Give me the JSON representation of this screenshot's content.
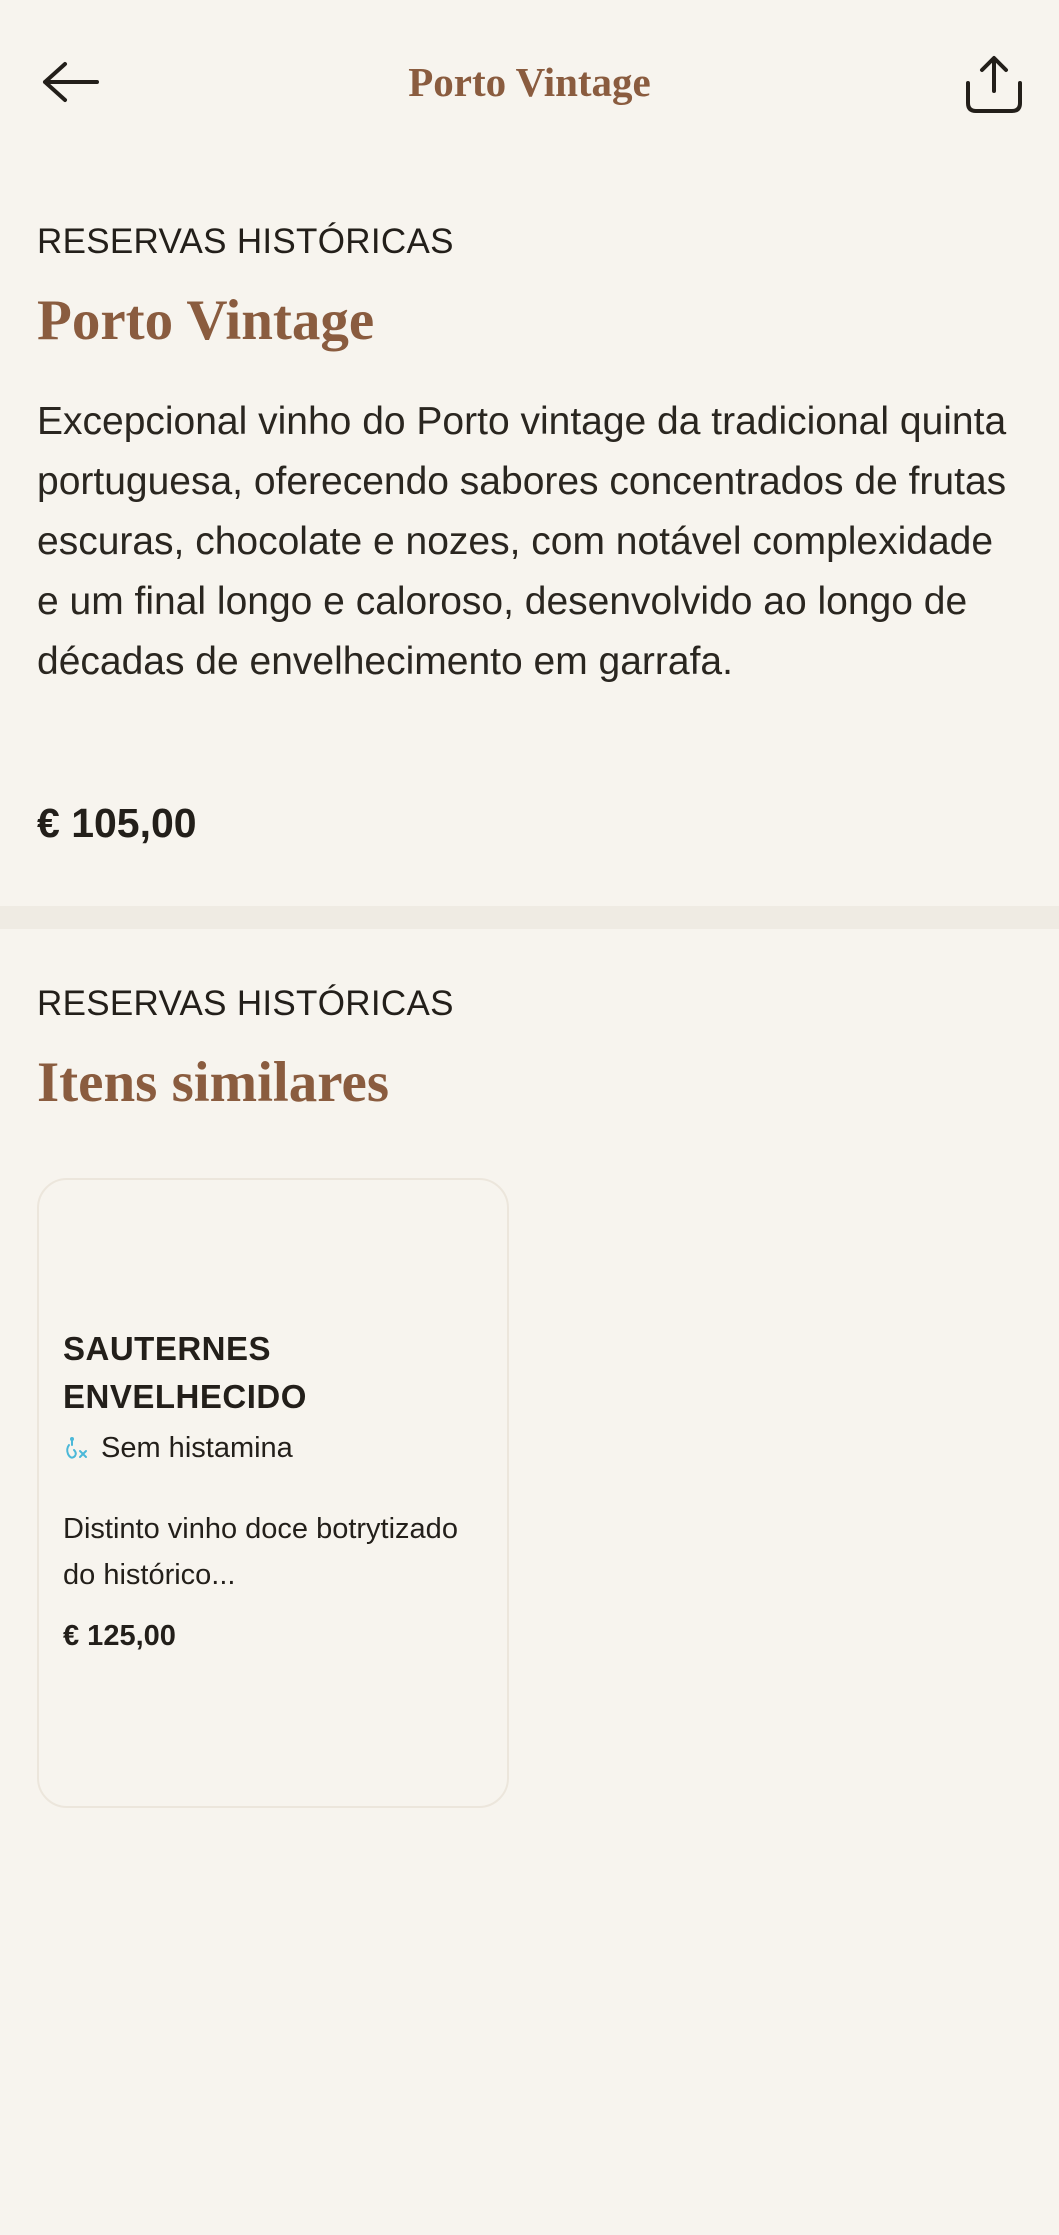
{
  "header": {
    "title": "Porto Vintage",
    "back_icon": "arrow-left-icon",
    "share_icon": "share-upload-icon"
  },
  "product": {
    "category": "RESERVAS HISTÓRICAS",
    "name": "Porto Vintage",
    "description": "Excepcional vinho do Porto vintage da tradicional quinta portuguesa, oferecendo sabores concentrados de frutas escuras, chocolate e nozes, com notável complexidade e um final longo e caloroso, desenvolvido ao longo de décadas de envelhecimento em garrafa.",
    "price": "€ 105,00"
  },
  "similar": {
    "category": "RESERVAS HISTÓRICAS",
    "title": "Itens similares",
    "items": [
      {
        "name": "SAUTERNES ENVELHECIDO",
        "tag": "Sem histamina",
        "tag_icon": "histamine-free-icon",
        "description": "Distinto vinho doce botrytizado do histórico...",
        "price": "€ 125,00"
      }
    ]
  },
  "colors": {
    "background": "#f7f4ee",
    "accent": "#8a5c3f",
    "text": "#231f1a",
    "tag_icon": "#4bb8d8"
  }
}
